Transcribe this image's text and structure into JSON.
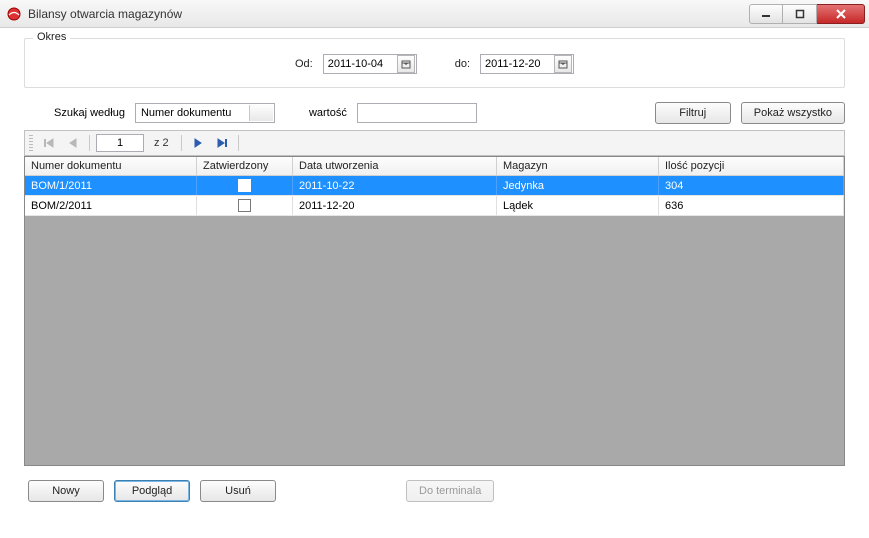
{
  "window": {
    "title": "Bilansy otwarcia magazynów"
  },
  "period": {
    "legend": "Okres",
    "from_label": "Od:",
    "to_label": "do:",
    "from_value": "2011-10-04",
    "to_value": "2011-12-20"
  },
  "search": {
    "by_label": "Szukaj według",
    "by_selected": "Numer dokumentu",
    "value_label": "wartość",
    "value": "",
    "filter_btn": "Filtruj",
    "showall_btn": "Pokaż wszystko"
  },
  "pager": {
    "current": "1",
    "total_text": "z 2"
  },
  "grid": {
    "columns": {
      "doc": "Numer dokumentu",
      "ok": "Zatwierdzony",
      "date": "Data utworzenia",
      "mag": "Magazyn",
      "qty": "Ilość pozycji"
    },
    "rows": [
      {
        "doc": "BOM/1/2011",
        "ok": true,
        "date": "2011-10-22",
        "mag": "Jedynka",
        "qty": "304",
        "selected": true
      },
      {
        "doc": "BOM/2/2011",
        "ok": false,
        "date": "2011-12-20",
        "mag": "Lądek",
        "qty": "636",
        "selected": false
      }
    ]
  },
  "buttons": {
    "new": "Nowy",
    "preview": "Podgląd",
    "delete": "Usuń",
    "terminal": "Do terminala"
  }
}
